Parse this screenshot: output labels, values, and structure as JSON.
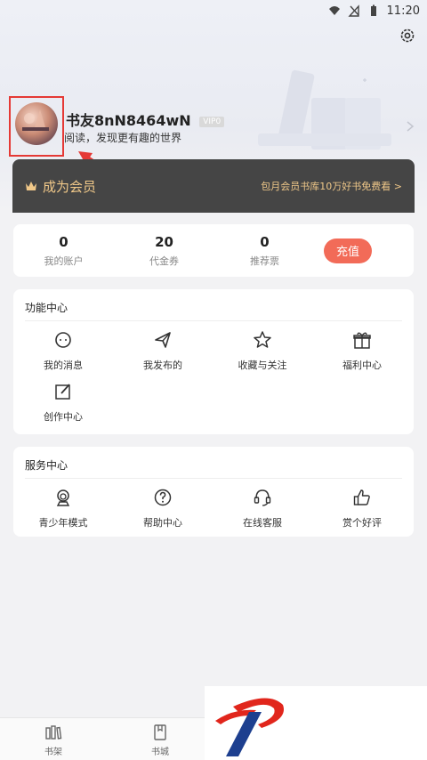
{
  "status_bar": {
    "time": "11:20"
  },
  "profile": {
    "username": "书友8nN8464wN",
    "vip_badge": "VIP0",
    "slogan": "阅读，发现更有趣的世界"
  },
  "member": {
    "title": "成为会员",
    "promo": "包月会员书库10万好书免费看 >"
  },
  "account": {
    "stats": [
      {
        "value": "0",
        "label": "我的账户"
      },
      {
        "value": "20",
        "label": "代金券"
      },
      {
        "value": "0",
        "label": "推荐票"
      }
    ],
    "recharge_label": "充值"
  },
  "function_center": {
    "title": "功能中心",
    "items": [
      {
        "label": "我的消息",
        "icon": "message-icon"
      },
      {
        "label": "我发布的",
        "icon": "send-icon"
      },
      {
        "label": "收藏与关注",
        "icon": "star-icon"
      },
      {
        "label": "福利中心",
        "icon": "gift-icon"
      },
      {
        "label": "创作中心",
        "icon": "edit-icon"
      }
    ]
  },
  "service_center": {
    "title": "服务中心",
    "items": [
      {
        "label": "青少年模式",
        "icon": "teen-icon"
      },
      {
        "label": "帮助中心",
        "icon": "help-icon"
      },
      {
        "label": "在线客服",
        "icon": "headset-icon"
      },
      {
        "label": "赏个好评",
        "icon": "thumbs-up-icon"
      }
    ]
  },
  "tabbar": {
    "tabs": [
      {
        "label": "书架",
        "icon": "bookshelf-icon"
      },
      {
        "label": "书城",
        "icon": "bookstore-icon"
      }
    ]
  },
  "colors": {
    "accent_red": "#f26b58",
    "member_gold": "#f0c889",
    "member_bg": "#454545",
    "annotation_red": "#e53935"
  }
}
